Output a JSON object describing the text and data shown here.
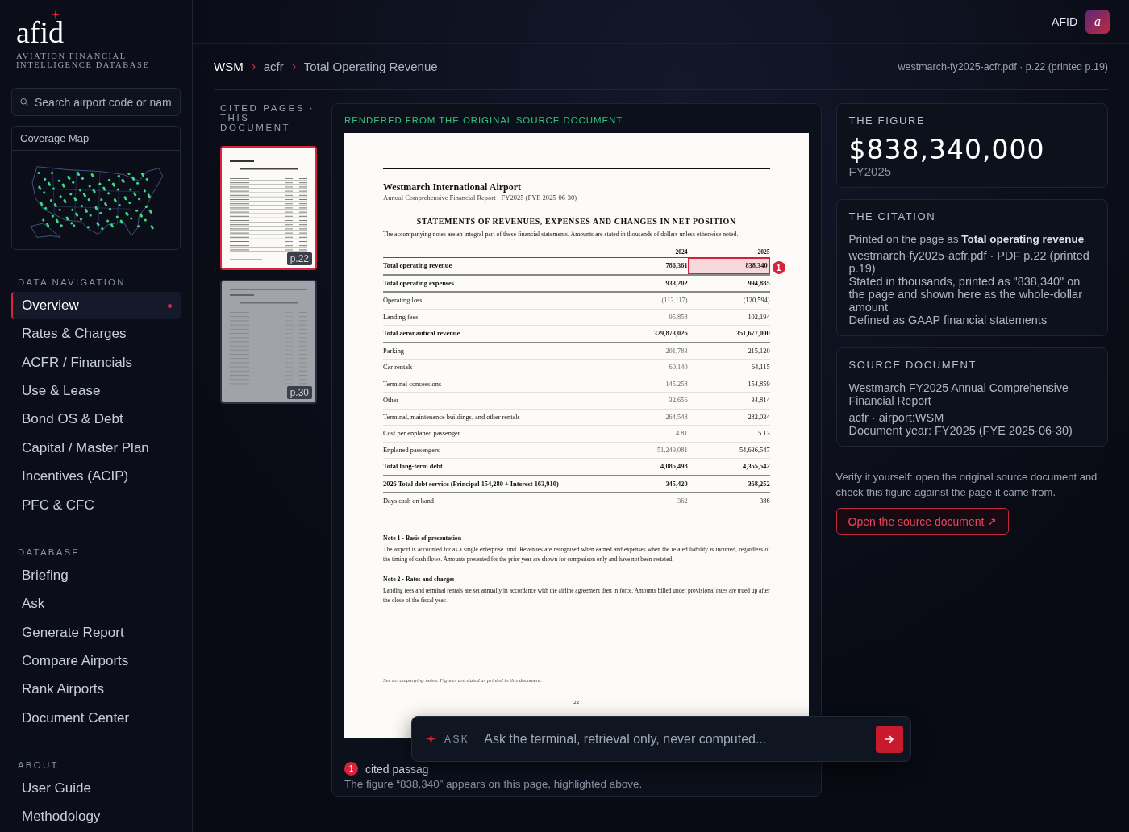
{
  "brand": {
    "logo": "afid",
    "tagline": "AVIATION FINANCIAL INTELLIGENCE DATABASE"
  },
  "search": {
    "placeholder": "Search airport code or nam"
  },
  "coverage_map": {
    "title": "Coverage Map"
  },
  "nav_sections": [
    {
      "heading": "DATA NAVIGATION",
      "items": [
        {
          "label": "Overview",
          "selected": true
        },
        {
          "label": "Rates & Charges",
          "selected": false
        },
        {
          "label": "ACFR / Financials",
          "selected": false
        },
        {
          "label": "Use & Lease",
          "selected": false
        },
        {
          "label": "Bond OS & Debt",
          "selected": false
        },
        {
          "label": "Capital / Master Plan",
          "selected": false
        },
        {
          "label": "Incentives (ACIP)",
          "selected": false
        },
        {
          "label": "PFC & CFC",
          "selected": false
        }
      ]
    },
    {
      "heading": "DATABASE",
      "items": [
        {
          "label": "Briefing",
          "selected": false
        },
        {
          "label": "Ask",
          "selected": false
        },
        {
          "label": "Generate Report",
          "selected": false
        },
        {
          "label": "Compare Airports",
          "selected": false
        },
        {
          "label": "Rank Airports",
          "selected": false
        },
        {
          "label": "Document Center",
          "selected": false
        }
      ]
    },
    {
      "heading": "ABOUT",
      "items": [
        {
          "label": "User Guide",
          "selected": false
        },
        {
          "label": "Methodology",
          "selected": false
        }
      ]
    }
  ],
  "topbar": {
    "user": "AFID",
    "avatar": "a"
  },
  "breadcrumb": [
    "WSM",
    "acfr",
    "Total Operating Revenue"
  ],
  "file_info": "westmarch-fy2025-acfr.pdf · p.22 (printed p.19)",
  "cited_pages": {
    "heading": "CITED PAGES · THIS DOCUMENT",
    "pages": [
      {
        "label": "p.22",
        "selected": true
      },
      {
        "label": "p.30",
        "selected": false
      }
    ]
  },
  "document": {
    "banner": "RENDERED FROM THE ORIGINAL SOURCE DOCUMENT.",
    "page": {
      "title": "Westmarch International Airport",
      "subtitle": "Annual Comprehensive Financial Report · FY2025 (FYE 2025-06-30)",
      "heading": "STATEMENTS OF REVENUES, EXPENSES AND CHANGES IN NET POSITION",
      "intro": "The accompanying notes are an integral part of these financial statements. Amounts are stated in thousands of dollars unless otherwise noted.",
      "columns": [
        "2024",
        "2025"
      ],
      "rows": [
        {
          "label": "Total operating revenue",
          "v2024": "786,361",
          "v2025": "838,340",
          "bold": true,
          "highlighted": true
        },
        {
          "label": "Total operating expenses",
          "v2024": "933,202",
          "v2025": "994,885",
          "bold": true,
          "highlighted": false
        },
        {
          "label": "Operating loss",
          "v2024": "(113,117)",
          "v2025": "(120,594)",
          "bold": false,
          "highlighted": false
        },
        {
          "label": "Landing fees",
          "v2024": "95,858",
          "v2025": "102,194",
          "bold": false,
          "highlighted": false
        },
        {
          "label": "Total aeronautical revenue",
          "v2024": "329,873,026",
          "v2025": "351,677,000",
          "bold": true,
          "highlighted": false
        },
        {
          "label": "Parking",
          "v2024": "201,783",
          "v2025": "215,120",
          "bold": false,
          "highlighted": false
        },
        {
          "label": "Car rentals",
          "v2024": "60,140",
          "v2025": "64,115",
          "bold": false,
          "highlighted": false
        },
        {
          "label": "Terminal concessions",
          "v2024": "145,258",
          "v2025": "154,859",
          "bold": false,
          "highlighted": false
        },
        {
          "label": "Other",
          "v2024": "32,656",
          "v2025": "34,814",
          "bold": false,
          "highlighted": false
        },
        {
          "label": "Terminal, maintenance buildings, and other rentals",
          "v2024": "264,548",
          "v2025": "282,034",
          "bold": false,
          "highlighted": false
        },
        {
          "label": "Cost per enplaned passenger",
          "v2024": "4.81",
          "v2025": "5.13",
          "bold": false,
          "highlighted": false
        },
        {
          "label": "Enplaned passengers",
          "v2024": "51,249,081",
          "v2025": "54,636,547",
          "bold": false,
          "highlighted": false
        },
        {
          "label": "Total long-term debt",
          "v2024": "4,085,498",
          "v2025": "4,355,542",
          "bold": true,
          "highlighted": false
        },
        {
          "label": "2026 Total debt service (Principal 154,280 + Interest 163,910)",
          "v2024": "345,420",
          "v2025": "368,252",
          "bold": true,
          "highlighted": false
        },
        {
          "label": "Days cash on hand",
          "v2024": "362",
          "v2025": "386",
          "bold": false,
          "highlighted": false
        }
      ],
      "notes": [
        {
          "title": "Note 1 - Basis of presentation",
          "text": "The airport is accounted for as a single enterprise fund. Revenues are recognised when earned and expenses when the related liability is incurred, regardless of the timing of cash flows. Amounts presented for the prior year are shown for comparison only and have not been restated."
        },
        {
          "title": "Note 2 - Rates and charges",
          "text": "Landing fees and terminal rentals are set annually in accordance with the airline agreement then in force. Amounts billed under provisional rates are trued up after the close of the fiscal year."
        }
      ],
      "footnote": "See accompanying notes. Figures are stated as printed in this document.",
      "page_number": "22"
    },
    "marker": "1",
    "caption_marker": "1",
    "caption_label": "cited passag",
    "caption": "The figure “838,340” appears on this page, highlighted above."
  },
  "figure": {
    "heading": "THE FIGURE",
    "value": "$838,340,000",
    "period": "FY2025"
  },
  "citation": {
    "heading": "THE CITATION",
    "printed_as": "Printed on the page as **Total operating revenue**",
    "lines": [
      "westmarch-fy2025-acfr.pdf · PDF p.22 (printed p.19)",
      "Stated in thousands, printed as \"838,340\" on the page and shown here as the whole-dollar amount",
      "Defined as GAAP financial statements"
    ]
  },
  "source_document": {
    "heading": "SOURCE DOCUMENT",
    "title": "Westmarch FY2025 Annual Comprehensive Financial Report",
    "lines": [
      "acfr · airport:WSM",
      "Document year: FY2025 (FYE 2025-06-30)"
    ]
  },
  "verify": {
    "text": "Verify it yourself: open the original source document and check this figure against the page it came from.",
    "button": "Open the source document ↗"
  },
  "ask": {
    "label": "ASK",
    "placeholder": "Ask the terminal, retrieval only, never computed..."
  }
}
